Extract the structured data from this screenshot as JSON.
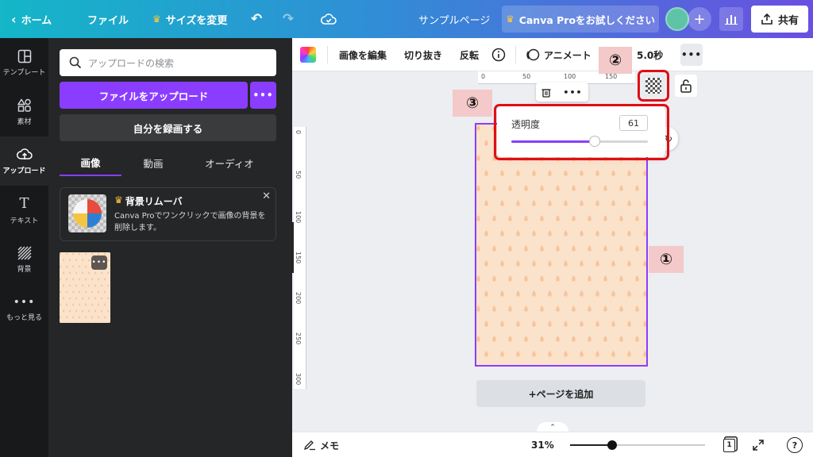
{
  "topbar": {
    "home": "ホーム",
    "file": "ファイル",
    "resize": "サイズを変更",
    "doc_title": "サンプルページ",
    "pro_trial": "Canva Proをお試しください",
    "share": "共有"
  },
  "rail": {
    "templates": "テンプレート",
    "elements": "素材",
    "uploads": "アップロード",
    "text": "テキスト",
    "background": "背景",
    "more": "もっと見る"
  },
  "panel": {
    "search_placeholder": "アップロードの検索",
    "upload_button": "ファイルをアップロード",
    "record_button": "自分を録画する",
    "tabs": [
      "画像",
      "動画",
      "オーディオ"
    ],
    "promo": {
      "title": "背景リムーバ",
      "desc": "Canva Proでワンクリックで画像の背景を削除します。"
    }
  },
  "toolbar": {
    "edit_image": "画像を編集",
    "crop": "切り抜き",
    "flip": "反転",
    "animate": "アニメート",
    "duration": "5.0秒"
  },
  "rulers": {
    "top": [
      "0",
      "50",
      "100",
      "150"
    ],
    "left": [
      "0",
      "50",
      "100",
      "150",
      "200",
      "250",
      "300"
    ]
  },
  "transparency": {
    "label": "透明度",
    "value": "61",
    "level": 0.61
  },
  "canvas": {
    "add_page": "+ページを追加"
  },
  "annotations": [
    "①",
    "②",
    "③"
  ],
  "bottombar": {
    "notes": "メモ",
    "zoom": "31%",
    "zoom_level": 0.31,
    "page_count": "1",
    "help": "?"
  },
  "colors": {
    "accent": "#8b3dff",
    "highlight": "#e10d14",
    "pattern_bg": "#fbe3cb",
    "pattern_drop": "#f5b98c"
  }
}
